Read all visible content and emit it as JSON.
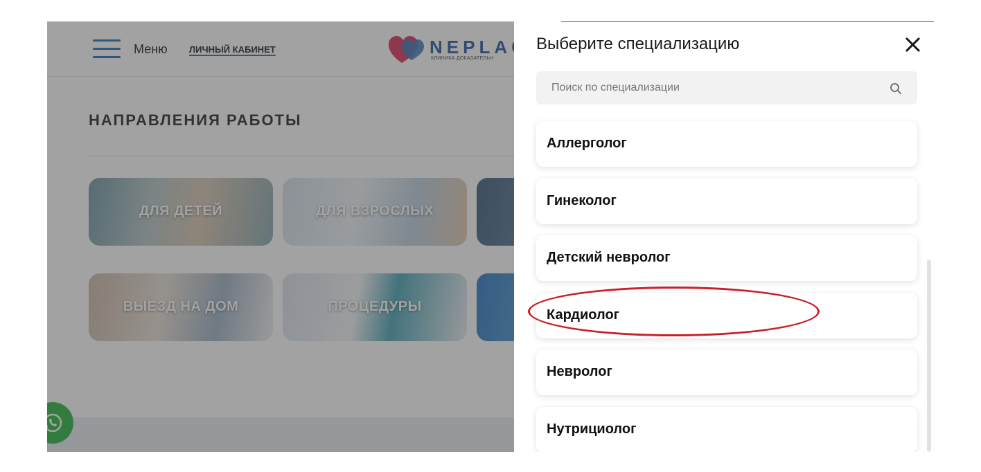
{
  "background_page": {
    "header": {
      "menu_label": "Меню",
      "cabinet_link": "ЛИЧНЫЙ КАБИНЕТ",
      "logo_text": "NEPLAC",
      "logo_subtitle": "КЛИНИКА ДОКАЗАТЕЛЬН"
    },
    "section_title": "НАПРАВЛЕНИЯ РАБОТЫ",
    "tiles": [
      {
        "label": "ДЛЯ ДЕТЕЙ"
      },
      {
        "label": "ДЛЯ ВЗРОСЛЫХ"
      },
      {
        "label": ""
      },
      {
        "label": "ВЫЕЗД НА ДОМ"
      },
      {
        "label": "ПРОЦЕДУРЫ"
      },
      {
        "label": ""
      }
    ],
    "whatsapp_icon": "whatsapp-icon"
  },
  "drawer": {
    "title": "Выберите специализацию",
    "close_icon": "close-icon",
    "search": {
      "placeholder": "Поиск по специализации",
      "value": "",
      "icon": "search-icon"
    },
    "specializations": [
      {
        "label": "Аллерголог"
      },
      {
        "label": "Гинеколог"
      },
      {
        "label": "Детский невролог"
      },
      {
        "label": "Кардиолог",
        "highlighted": true
      },
      {
        "label": "Невролог"
      },
      {
        "label": "Нутрициолог"
      }
    ]
  },
  "colors": {
    "accent_blue": "#1f6fb4",
    "highlight_red": "#c8202a",
    "whatsapp_green": "#2bb741"
  }
}
